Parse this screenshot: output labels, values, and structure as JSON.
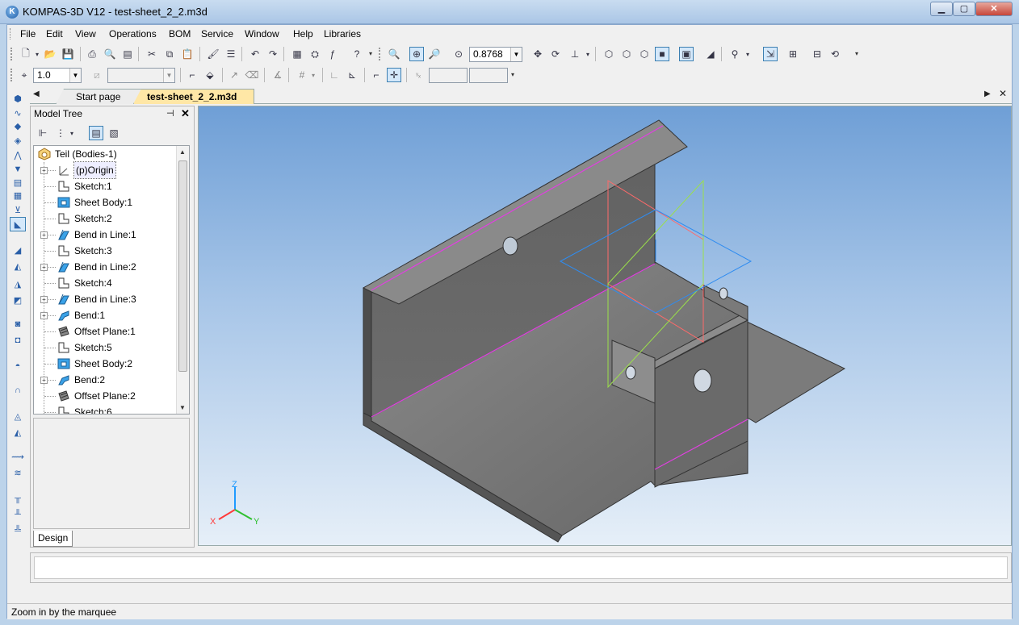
{
  "window": {
    "title": "KOMPAS-3D V12 - test-sheet_2_2.m3d",
    "app_icon_letter": "K",
    "min_glyph": "▁",
    "max_glyph": "▢",
    "close_glyph": "✕"
  },
  "menu": [
    "File",
    "Edit",
    "View",
    "Operations",
    "BOM",
    "Service",
    "Window",
    "Help",
    "Libraries"
  ],
  "toolbar": {
    "zoom_value": "0.8768",
    "step_value": "1.0"
  },
  "tabs": {
    "start_page": "Start page",
    "active_doc": "test-sheet_2_2.m3d",
    "nav_left": "◀",
    "nav_right": "▶",
    "close": "✕"
  },
  "model_tree": {
    "title": "Model Tree",
    "pin_glyph": "📌",
    "close_glyph": "✕",
    "root": "Teil (Bodies-1)",
    "items": [
      {
        "label": "(p)Origin",
        "expandable": true,
        "icon": "origin-icon"
      },
      {
        "label": "Sketch:1",
        "expandable": false,
        "icon": "sketch-icon"
      },
      {
        "label": "Sheet Body:1",
        "expandable": false,
        "icon": "sheet-body-icon"
      },
      {
        "label": "Sketch:2",
        "expandable": false,
        "icon": "sketch-icon"
      },
      {
        "label": "Bend in Line:1",
        "expandable": true,
        "icon": "bend-in-line-icon"
      },
      {
        "label": "Sketch:3",
        "expandable": false,
        "icon": "sketch-icon"
      },
      {
        "label": "Bend in Line:2",
        "expandable": true,
        "icon": "bend-in-line-icon"
      },
      {
        "label": "Sketch:4",
        "expandable": false,
        "icon": "sketch-icon"
      },
      {
        "label": "Bend in Line:3",
        "expandable": true,
        "icon": "bend-in-line-icon"
      },
      {
        "label": "Bend:1",
        "expandable": true,
        "icon": "bend-icon"
      },
      {
        "label": "Offset Plane:1",
        "expandable": false,
        "icon": "offset-plane-icon"
      },
      {
        "label": "Sketch:5",
        "expandable": false,
        "icon": "sketch-icon"
      },
      {
        "label": "Sheet Body:2",
        "expandable": false,
        "icon": "sheet-body-icon"
      },
      {
        "label": "Bend:2",
        "expandable": true,
        "icon": "bend-icon"
      },
      {
        "label": "Offset Plane:2",
        "expandable": false,
        "icon": "offset-plane-icon"
      },
      {
        "label": "Sketch:6",
        "expandable": false,
        "icon": "sketch-icon"
      }
    ],
    "design_tab": "Design"
  },
  "triad": {
    "x": "X",
    "y": "Y",
    "z": "Z"
  },
  "status": {
    "text": "Zoom in by the marquee"
  },
  "colors": {
    "accent_tab": "#ffe7a6",
    "part_face": "#7a7a7a",
    "edge_line": "#e040e0",
    "plane_red": "#ff6a6a",
    "plane_green": "#9be04a",
    "plane_blue": "#2f8cf0"
  }
}
